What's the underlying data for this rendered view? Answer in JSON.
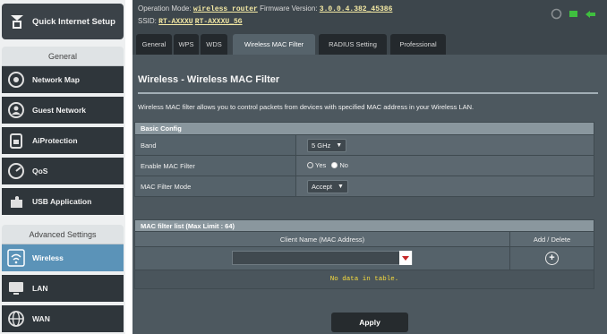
{
  "sidebar": {
    "quick_setup": "Quick Internet Setup",
    "general_header": "General",
    "general_items": [
      {
        "label": "Network Map",
        "icon": "network-map-icon"
      },
      {
        "label": "Guest Network",
        "icon": "guest-network-icon"
      },
      {
        "label": "AiProtection",
        "icon": "lock-icon"
      },
      {
        "label": "QoS",
        "icon": "gauge-icon"
      },
      {
        "label": "USB Application",
        "icon": "puzzle-icon"
      }
    ],
    "advanced_header": "Advanced Settings",
    "advanced_items": [
      {
        "label": "Wireless",
        "icon": "wifi-icon",
        "active": true
      },
      {
        "label": "LAN",
        "icon": "monitor-icon",
        "active": false
      },
      {
        "label": "WAN",
        "icon": "globe-icon",
        "active": false
      }
    ]
  },
  "topbar": {
    "op_mode_label": "Operation Mode:",
    "op_mode_value": "wireless router",
    "fw_label": "Firmware Version:",
    "fw_value": "3.0.0.4.382_45386",
    "ssid_label": "SSID:",
    "ssid_24": "RT-AXXXU",
    "ssid_5": "RT-AXXXU_5G"
  },
  "tabs": [
    "General",
    "WPS",
    "WDS",
    "Wireless MAC Filter",
    "RADIUS Setting",
    "Professional"
  ],
  "active_tab": "Wireless MAC Filter",
  "page": {
    "title": "Wireless - Wireless MAC Filter",
    "description": "Wireless MAC filter allows you to control packets from devices with specified MAC address in your Wireless LAN."
  },
  "basic_config": {
    "header": "Basic Config",
    "band_label": "Band",
    "band_value": "5 GHz",
    "enable_label": "Enable MAC Filter",
    "yes_label": "Yes",
    "no_label": "No",
    "enabled": "No",
    "mode_label": "MAC Filter Mode",
    "mode_value": "Accept"
  },
  "mac_list": {
    "header": "MAC filter list (Max Limit : 64)",
    "col_client": "Client Name (MAC Address)",
    "col_action": "Add / Delete",
    "empty_text": "No data in table."
  },
  "apply_label": "Apply",
  "colors": {
    "active_item": "#5b93b8",
    "panel": "#4d585f",
    "no_data": "#f7dc3d"
  }
}
